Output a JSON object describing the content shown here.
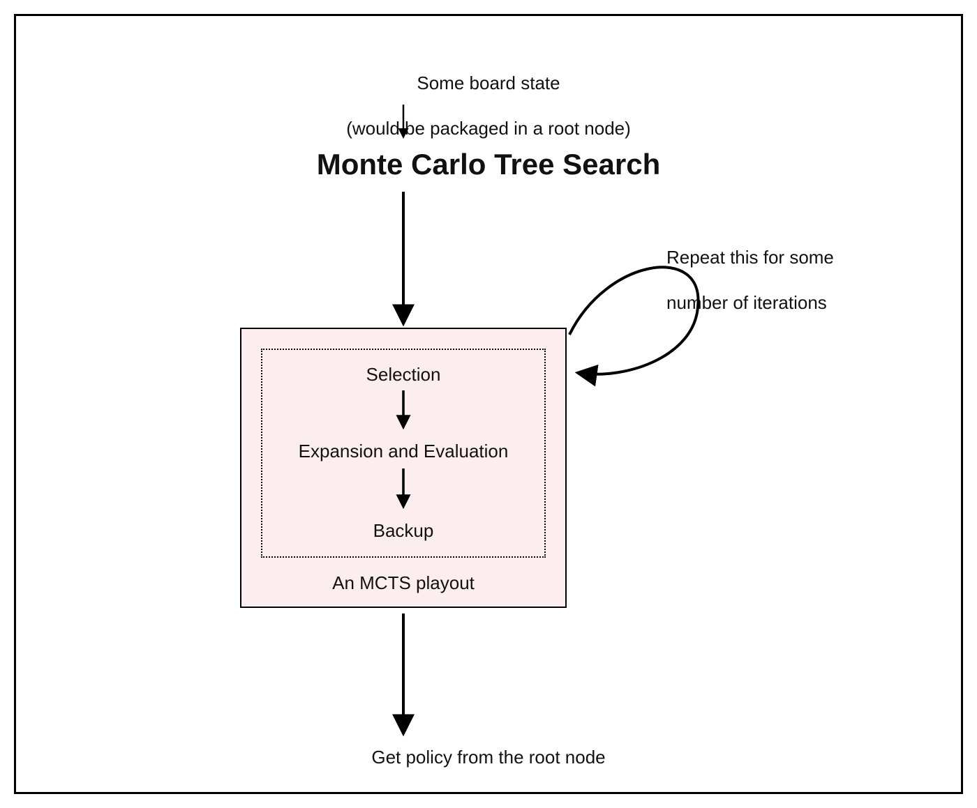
{
  "input_line1": "Some board state",
  "input_line2": "(would be packaged in a root node)",
  "title": "Monte Carlo Tree Search",
  "playout": {
    "step1": "Selection",
    "step2": "Expansion and Evaluation",
    "step3": "Backup",
    "caption": "An MCTS playout"
  },
  "repeat_line1": "Repeat this for some",
  "repeat_line2": "number of iterations",
  "output": "Get policy from the root node"
}
